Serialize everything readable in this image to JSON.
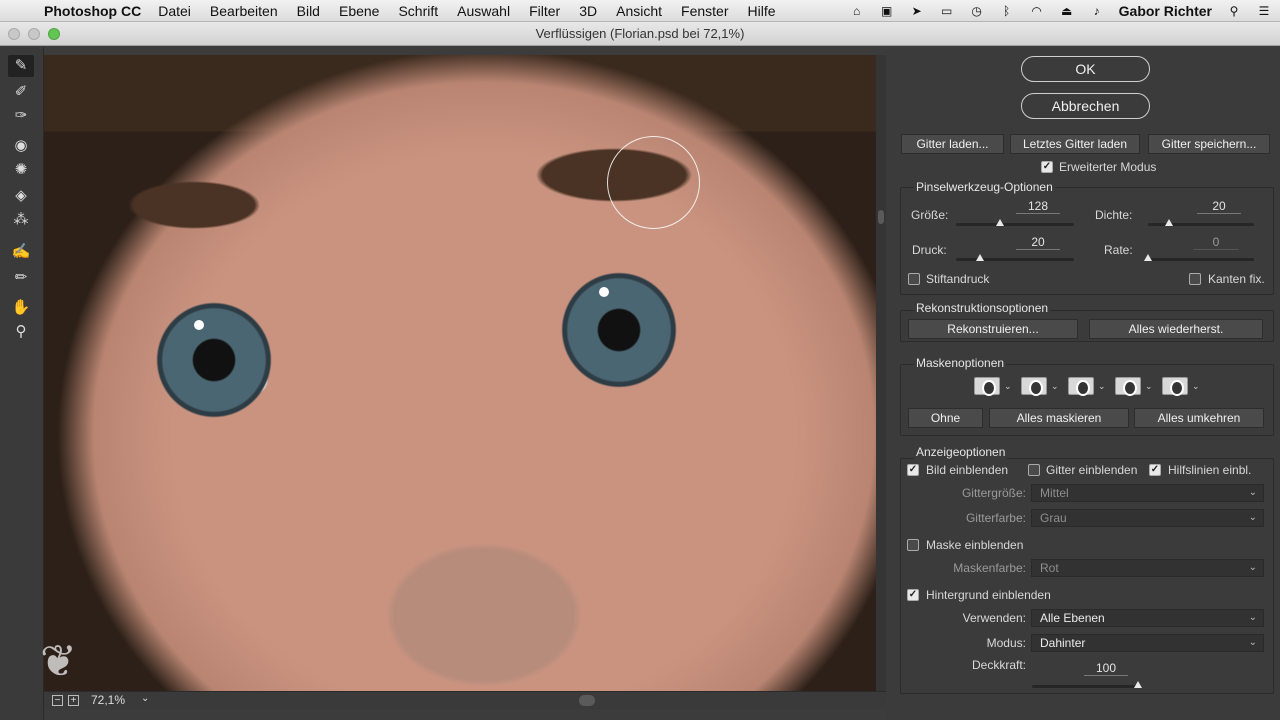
{
  "menubar": {
    "app_name": "Photoshop CC",
    "items": [
      "Datei",
      "Bearbeiten",
      "Bild",
      "Ebene",
      "Schrift",
      "Auswahl",
      "Filter",
      "3D",
      "Ansicht",
      "Fenster",
      "Hilfe"
    ],
    "user": "Gabor Richter"
  },
  "window": {
    "title": "Verflüssigen (Florian.psd bei 72,1%)"
  },
  "status": {
    "zoom": "72,1%"
  },
  "buttons": {
    "ok": "OK",
    "cancel": "Abbrechen",
    "load_mesh": "Gitter laden...",
    "load_last_mesh": "Letztes Gitter laden",
    "save_mesh": "Gitter speichern..."
  },
  "advanced_mode": {
    "label": "Erweiterter Modus",
    "checked": true
  },
  "brush_options": {
    "title": "Pinselwerkzeug-Optionen",
    "size_label": "Größe:",
    "size_value": "128",
    "size_level": 0.37,
    "density_label": "Dichte:",
    "density_value": "20",
    "density_level": 0.2,
    "pressure_label": "Druck:",
    "pressure_value": "20",
    "pressure_level": 0.2,
    "rate_label": "Rate:",
    "rate_value": "0",
    "rate_level": 0.0,
    "stylus_label": "Stiftandruck",
    "stylus_checked": false,
    "pin_edges_label": "Kanten fix.",
    "pin_edges_checked": false
  },
  "reconstruct_options": {
    "title": "Rekonstruktionsoptionen",
    "reconstruct": "Rekonstruieren...",
    "restore_all": "Alles wiederherst."
  },
  "mask_options": {
    "title": "Maskenoptionen",
    "none": "Ohne",
    "mask_all": "Alles maskieren",
    "invert_all": "Alles umkehren"
  },
  "view_options": {
    "title": "Anzeigeoptionen",
    "show_image": "Bild einblenden",
    "show_image_checked": true,
    "show_mesh": "Gitter einblenden",
    "show_mesh_checked": false,
    "show_guides": "Hilfslinien einbl.",
    "show_guides_checked": true,
    "mesh_size_label": "Gittergröße:",
    "mesh_size_value": "Mittel",
    "mesh_color_label": "Gitterfarbe:",
    "mesh_color_value": "Grau",
    "show_mask": "Maske einblenden",
    "show_mask_checked": false,
    "mask_color_label": "Maskenfarbe:",
    "mask_color_value": "Rot",
    "show_backdrop": "Hintergrund einblenden",
    "show_backdrop_checked": true,
    "use_label": "Verwenden:",
    "use_value": "Alle Ebenen",
    "mode_label": "Modus:",
    "mode_value": "Dahinter",
    "opacity_label": "Deckkraft:",
    "opacity_value": "100",
    "opacity_level": 1.0
  }
}
